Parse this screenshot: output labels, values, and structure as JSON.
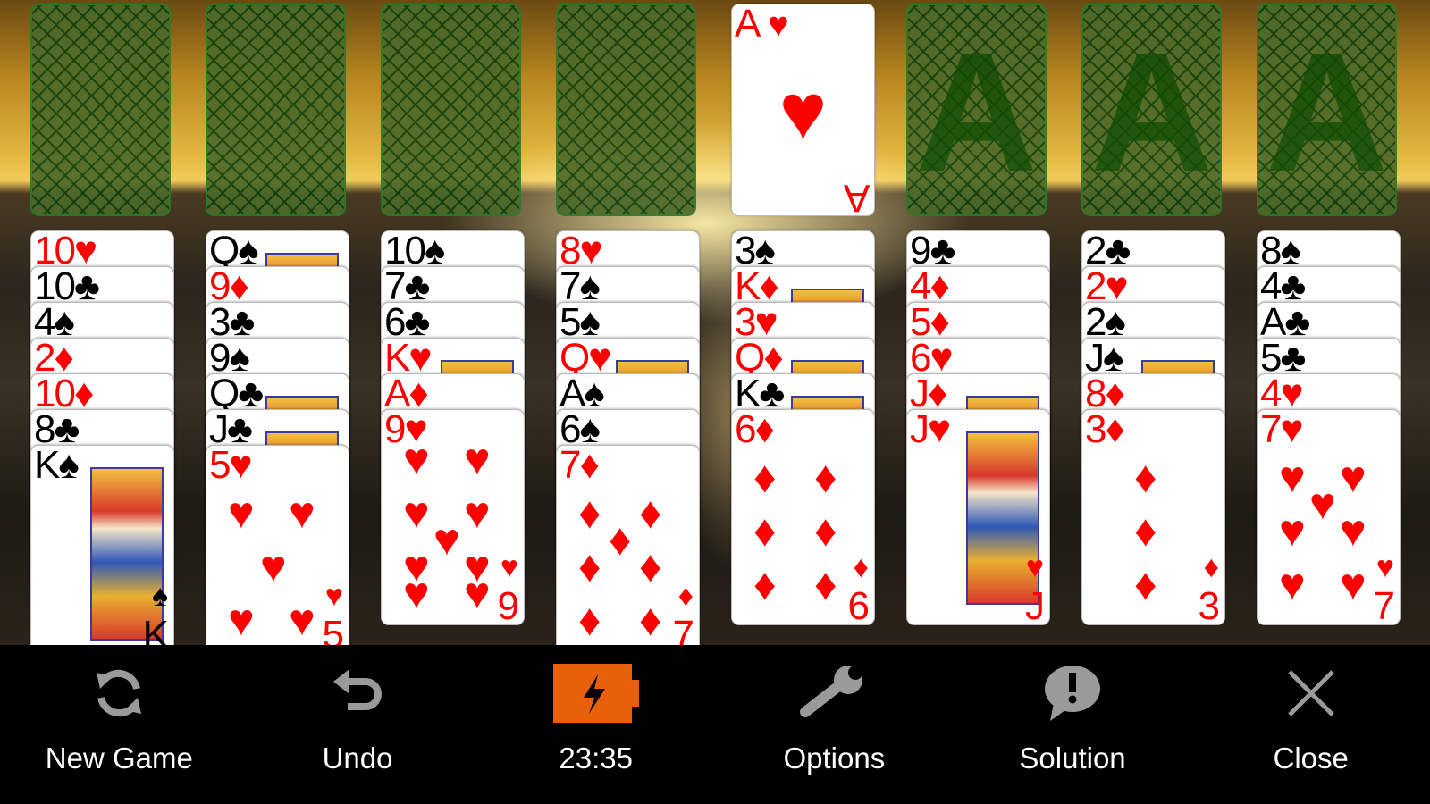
{
  "free_cells": [
    null,
    null,
    null,
    null
  ],
  "foundations": [
    {
      "card": {
        "rank": "A",
        "suit": "♥",
        "color": "red"
      },
      "placeholder": "A"
    },
    {
      "card": null,
      "placeholder": "A"
    },
    {
      "card": null,
      "placeholder": "A"
    },
    {
      "card": null,
      "placeholder": "A"
    }
  ],
  "tableau": [
    [
      "10♥",
      "10♣",
      "4♠",
      "2♦",
      "10♦",
      "8♣",
      "K♠"
    ],
    [
      "Q♠",
      "9♦",
      "3♣",
      "9♠",
      "Q♣",
      "J♣",
      "5♥"
    ],
    [
      "10♠",
      "7♣",
      "6♣",
      "K♥",
      "A♦",
      "9♥"
    ],
    [
      "8♥",
      "7♠",
      "5♠",
      "Q♥",
      "A♠",
      "6♠",
      "7♦"
    ],
    [
      "3♠",
      "K♦",
      "3♥",
      "Q♦",
      "K♣",
      "6♦"
    ],
    [
      "9♣",
      "4♦",
      "5♦",
      "6♥",
      "J♦",
      "J♥"
    ],
    [
      "2♣",
      "2♥",
      "2♠",
      "J♠",
      "8♦",
      "3♦"
    ],
    [
      "8♠",
      "4♣",
      "A♣",
      "5♣",
      "4♥",
      "7♥"
    ]
  ],
  "toolbar": [
    {
      "label": "New Game",
      "icon": "refresh-icon"
    },
    {
      "label": "Undo",
      "icon": "undo-icon"
    },
    {
      "label": "23:35",
      "icon": "battery-charging-icon"
    },
    {
      "label": "Options",
      "icon": "wrench-icon"
    },
    {
      "label": "Solution",
      "icon": "exclamation-bubble-icon"
    },
    {
      "label": "Close",
      "icon": "close-icon"
    }
  ],
  "colors": {
    "red_suit": "#ff0000",
    "black_suit": "#000000",
    "battery": "#e8610a",
    "toolbar_bg": "#000000",
    "icon_gray": "#9a9a9a"
  }
}
